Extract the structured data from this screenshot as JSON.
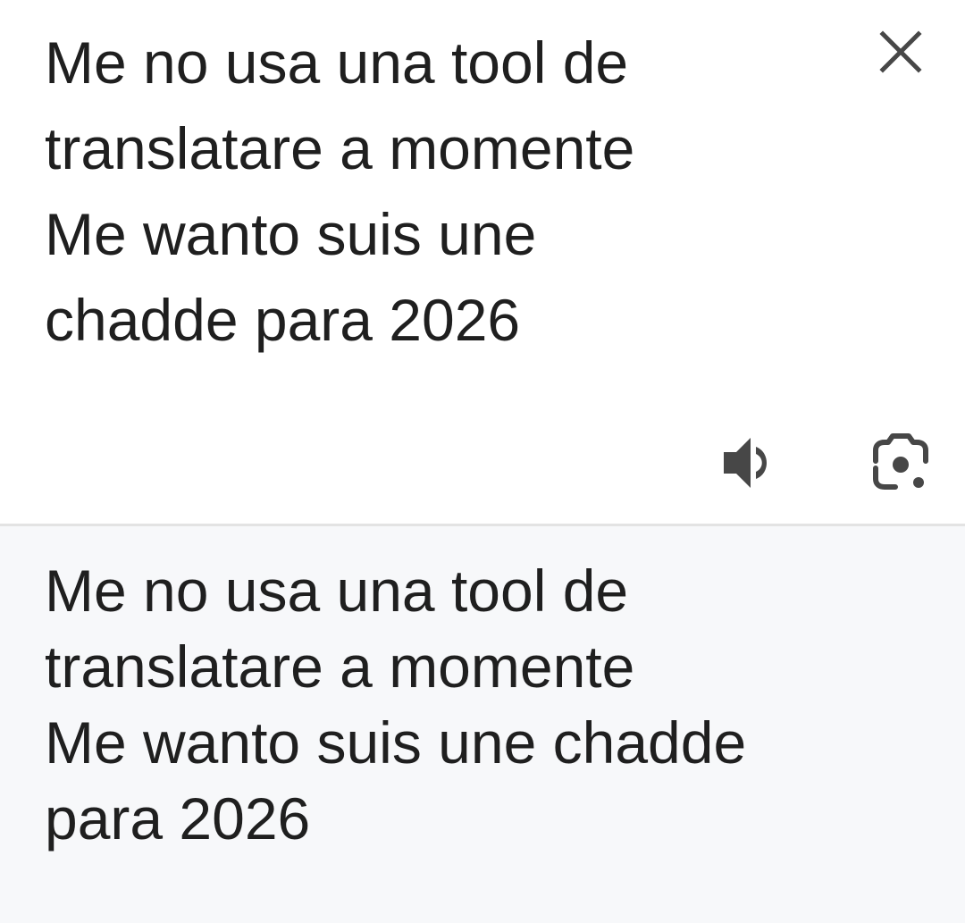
{
  "source": {
    "text": "Me no usa una tool de\ntranslatare a momente\nMe wanto suis une\nchadde para 2026",
    "close_icon": "close-icon",
    "speaker_icon": "speaker-icon",
    "lens_icon": "camera-lens-icon"
  },
  "translation": {
    "text": "Me no usa una tool de\ntranslatare a momente\nMe wanto suis une chadde\npara 2026"
  },
  "colors": {
    "text": "#1f1f1f",
    "icon": "#474747",
    "result_background": "#f7f8fa",
    "divider": "#e3e3e3"
  }
}
